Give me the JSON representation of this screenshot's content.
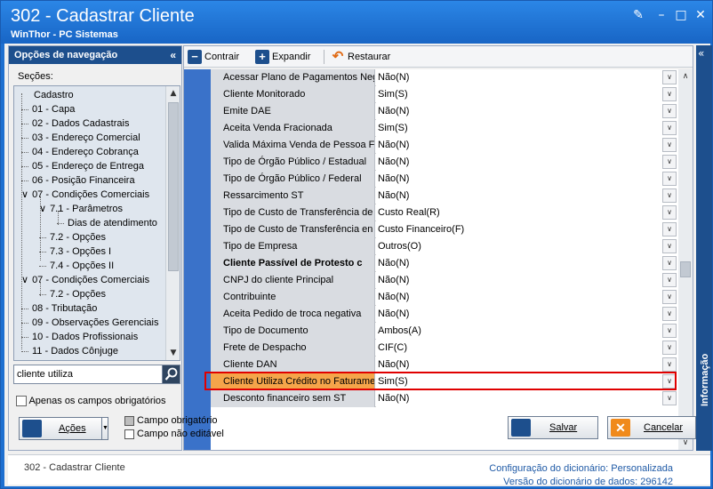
{
  "window": {
    "title": "302 - Cadastrar Cliente",
    "subtitle": "WinThor - PC Sistemas"
  },
  "nav": {
    "header": "Opções de navegação",
    "sections_label": "Seções:",
    "items": [
      {
        "label": "Cadastro",
        "level": 0,
        "expander": ""
      },
      {
        "label": "01 - Capa",
        "level": 1,
        "expander": ""
      },
      {
        "label": "02 - Dados Cadastrais",
        "level": 1,
        "expander": ""
      },
      {
        "label": "03 - Endereço Comercial",
        "level": 1,
        "expander": ""
      },
      {
        "label": "04 - Endereço Cobrança",
        "level": 1,
        "expander": ""
      },
      {
        "label": "05 - Endereço de Entrega",
        "level": 1,
        "expander": ""
      },
      {
        "label": "06 - Posição Financeira",
        "level": 1,
        "expander": ""
      },
      {
        "label": "07 - Condições Comerciais",
        "level": 1,
        "expander": "∨"
      },
      {
        "label": "7.1 - Parâmetros",
        "level": 2,
        "expander": "∨"
      },
      {
        "label": "Dias de atendimento",
        "level": 3,
        "expander": ""
      },
      {
        "label": "7.2 - Opções",
        "level": 2,
        "expander": ""
      },
      {
        "label": "7.3 - Opções I",
        "level": 2,
        "expander": ""
      },
      {
        "label": "7.4 - Opções II",
        "level": 2,
        "expander": ""
      },
      {
        "label": "07 - Condições Comerciais",
        "level": 1,
        "expander": "∨"
      },
      {
        "label": "7.2 - Opções",
        "level": 2,
        "expander": ""
      },
      {
        "label": "08 - Tributação",
        "level": 1,
        "expander": ""
      },
      {
        "label": "09 - Observações Gerenciais",
        "level": 1,
        "expander": ""
      },
      {
        "label": "10 - Dados Profissionais",
        "level": 1,
        "expander": ""
      },
      {
        "label": "11 - Dados Cônjuge",
        "level": 1,
        "expander": ""
      }
    ],
    "search_value": "cliente utiliza",
    "only_required_label": "Apenas os campos obrigatórios"
  },
  "toolbar": {
    "collapse": "Contrair",
    "expand": "Expandir",
    "restore": "Restaurar"
  },
  "grid": {
    "rows": [
      {
        "label": "Acessar Plano de Pagamentos Neg",
        "value": "Não(N)",
        "bold": false
      },
      {
        "label": "Cliente Monitorado",
        "value": "Sim(S)",
        "bold": false
      },
      {
        "label": "Emite DAE",
        "value": "Não(N)",
        "bold": false
      },
      {
        "label": "Aceita Venda Fracionada",
        "value": "Sim(S)",
        "bold": false
      },
      {
        "label": "Valida Máxima Venda de Pessoa Fí",
        "value": "Não(N)",
        "bold": false
      },
      {
        "label": "Tipo de Órgão Público / Estadual",
        "value": "Não(N)",
        "bold": false
      },
      {
        "label": "Tipo de Órgão Público / Federal",
        "value": "Não(N)",
        "bold": false
      },
      {
        "label": "Ressarcimento ST",
        "value": "Não(N)",
        "bold": false
      },
      {
        "label": "Tipo de Custo de Transferência de",
        "value": "Custo Real(R)",
        "bold": false
      },
      {
        "label": "Tipo de Custo de Transferência en",
        "value": "Custo Financeiro(F)",
        "bold": false
      },
      {
        "label": "Tipo de Empresa",
        "value": "Outros(O)",
        "bold": false
      },
      {
        "label": "Cliente Passível de Protesto c",
        "value": "Não(N)",
        "bold": true
      },
      {
        "label": "CNPJ do cliente Principal",
        "value": "Não(N)",
        "bold": false
      },
      {
        "label": "Contribuinte",
        "value": "Não(N)",
        "bold": false
      },
      {
        "label": "Aceita Pedido de troca negativa",
        "value": "Não(N)",
        "bold": false
      },
      {
        "label": "Tipo de Documento",
        "value": "Ambos(A)",
        "bold": false
      },
      {
        "label": "Frete de Despacho",
        "value": "CIF(C)",
        "bold": false
      },
      {
        "label": "Cliente DAN",
        "value": "Não(N)",
        "bold": false
      },
      {
        "label": "Cliente Utiliza Crédito no Faturame",
        "value": "Sim(S)",
        "bold": false,
        "highlighted": true
      },
      {
        "label": "Desconto financeiro sem ST",
        "value": "Não(N)",
        "bold": false
      }
    ]
  },
  "info_tab": "Informação",
  "buttons": {
    "actions": "Ações",
    "save": "Salvar",
    "cancel": "Cancelar"
  },
  "legend": {
    "required": "Campo obrigatório",
    "not_editable": "Campo não editável"
  },
  "status": {
    "left": "302 - Cadastrar Cliente",
    "dict_config_label": "Configuração do dicionário:",
    "dict_config_value": "Personalizada",
    "dict_version_label": "Versão do dicionário de dados:",
    "dict_version_value": "296142"
  },
  "colors": {
    "title_bar": "#1d6fd0",
    "nav_header": "#1d4f8d",
    "highlight": "#f5a54a",
    "highlight_border": "#e00000"
  }
}
